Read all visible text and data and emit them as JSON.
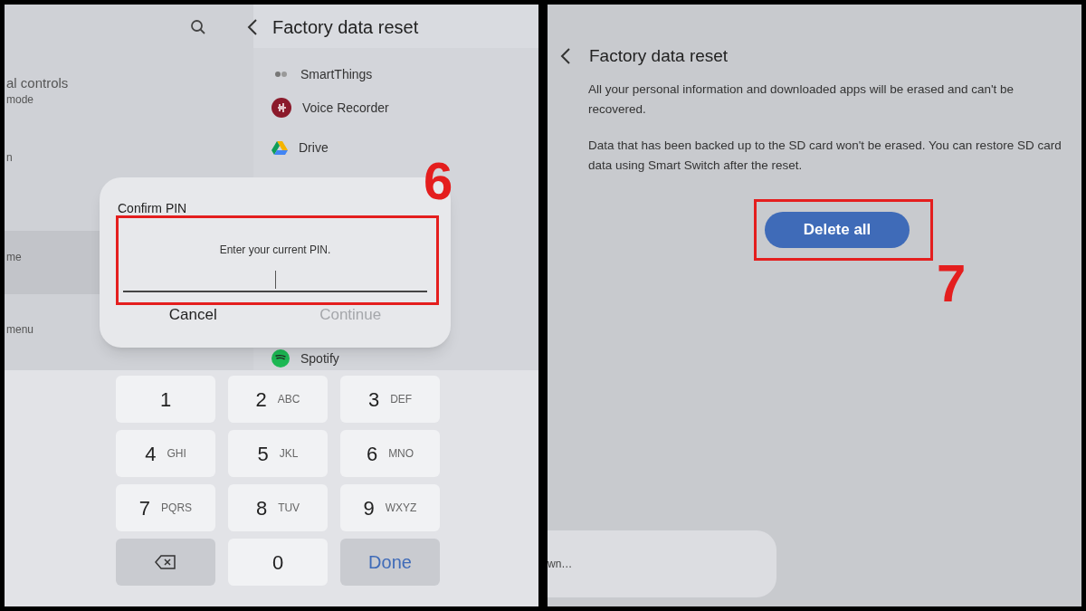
{
  "left_screen": {
    "title": "Factory data reset",
    "sidebar_fragments": [
      {
        "text": "al controls",
        "selected": false
      },
      {
        "text": "mode",
        "selected": false
      },
      {
        "text": "n",
        "selected": false
      },
      {
        "text": "me",
        "selected": true
      },
      {
        "text": "menu",
        "selected": false
      }
    ],
    "apps": [
      {
        "name": "SmartThings",
        "kind": "smartthings"
      },
      {
        "name": "Voice Recorder",
        "kind": "recorder"
      },
      {
        "name": "Drive",
        "kind": "drive"
      },
      {
        "name": "Spotify",
        "kind": "spotify"
      }
    ],
    "dialog": {
      "title": "Confirm PIN",
      "prompt": "Enter your current PIN.",
      "buttons": [
        {
          "label": "Cancel",
          "disabled": false
        },
        {
          "label": "Continue",
          "disabled": true
        }
      ]
    },
    "keypad": [
      {
        "kind": "digit",
        "digit": "1"
      },
      {
        "kind": "digit",
        "digit": "2",
        "letters": "ABC"
      },
      {
        "kind": "digit",
        "digit": "3",
        "letters": "DEF"
      },
      {
        "kind": "digit",
        "digit": "4",
        "letters": "GHI"
      },
      {
        "kind": "digit",
        "digit": "5",
        "letters": "JKL"
      },
      {
        "kind": "digit",
        "digit": "6",
        "letters": "MNO"
      },
      {
        "kind": "digit",
        "digit": "7",
        "letters": "PQRS"
      },
      {
        "kind": "digit",
        "digit": "8",
        "letters": "TUV"
      },
      {
        "kind": "digit",
        "digit": "9",
        "letters": "WXYZ"
      },
      {
        "kind": "backspace"
      },
      {
        "kind": "digit",
        "digit": "0"
      },
      {
        "kind": "done",
        "label": "Done"
      }
    ],
    "step": "6"
  },
  "right_screen": {
    "title": "Factory data reset",
    "paragraphs": [
      "All your personal information and downloaded apps will be erased and can't be recovered.",
      "Data that has been backed up to the SD card won't be erased. You can restore SD card data using Smart Switch after the reset."
    ],
    "button": "Delete all",
    "card_text": "wn…",
    "step": "7"
  }
}
